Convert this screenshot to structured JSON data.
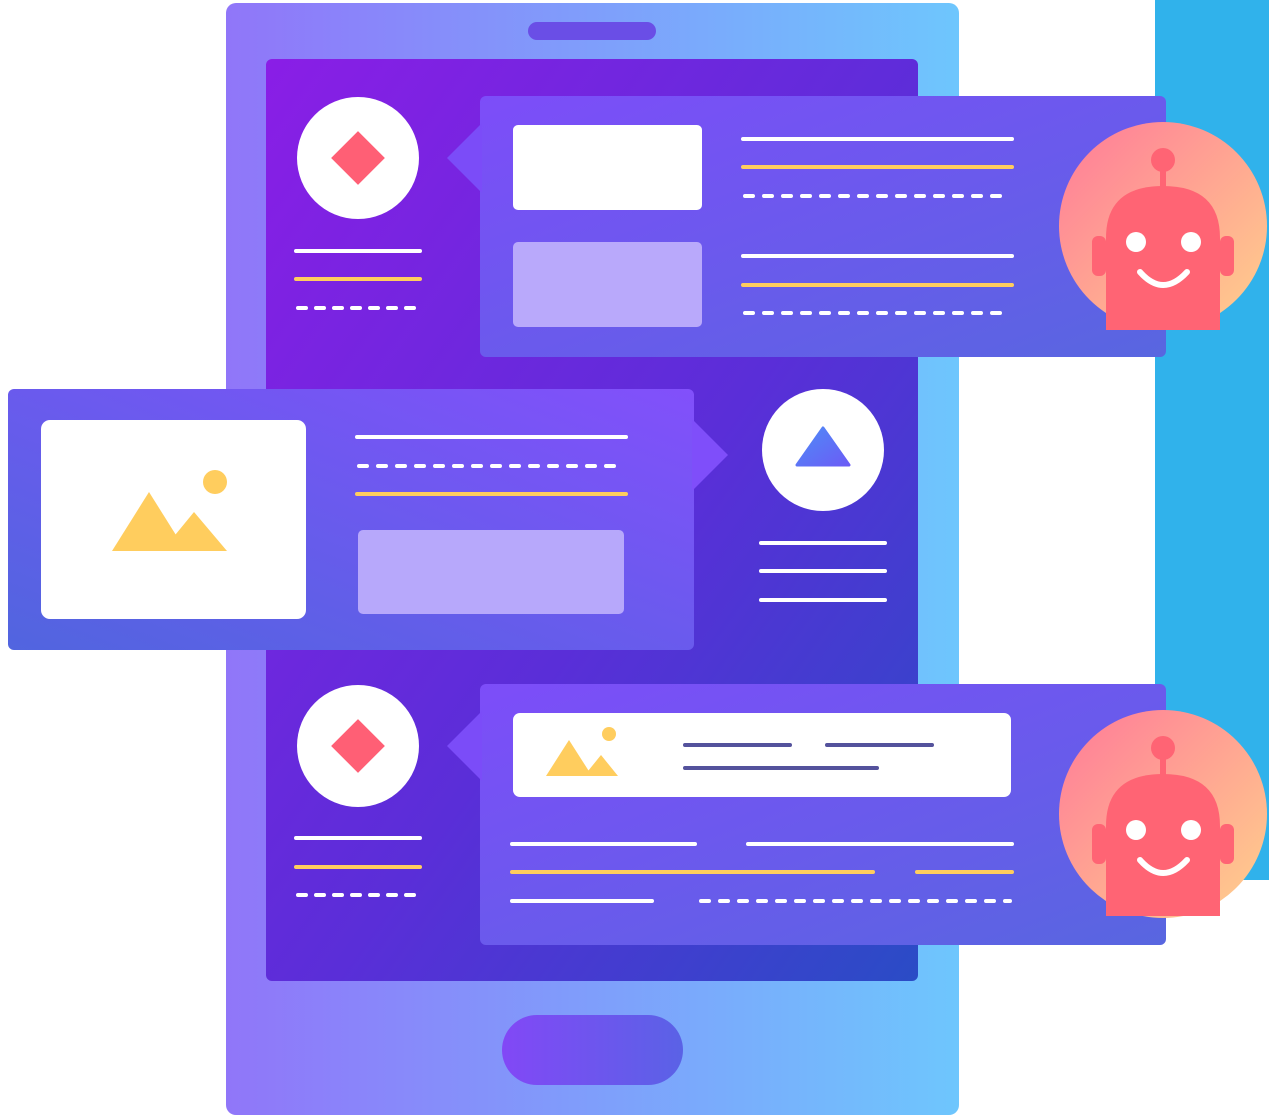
{
  "illustration": {
    "subject": "tablet-chat-with-bots",
    "colors": {
      "device_gradient_start": "#9076F9",
      "device_gradient_end": "#6EC6FD",
      "screen_gradient_start": "#8A1EE6",
      "screen_gradient_end": "#2A4CC6",
      "bubble_gradient_start": "#7B4CF8",
      "bubble_gradient_end": "#5B63E2",
      "accent_blue_panel": "#30B2EB",
      "accent_yellow": "#FFCD5E",
      "accent_red": "#FF5F75",
      "bot_gradient_start": "#FF7C93",
      "bot_gradient_end": "#FFC98C",
      "placeholder_light": "#B7A8FB",
      "white": "#FFFFFF"
    },
    "icons": {
      "top_avatar": "diamond-icon",
      "middle_avatar": "triangle-icon",
      "bottom_avatar": "diamond-icon",
      "image_placeholder": "mountain-image-icon",
      "bot": "robot-icon"
    }
  }
}
